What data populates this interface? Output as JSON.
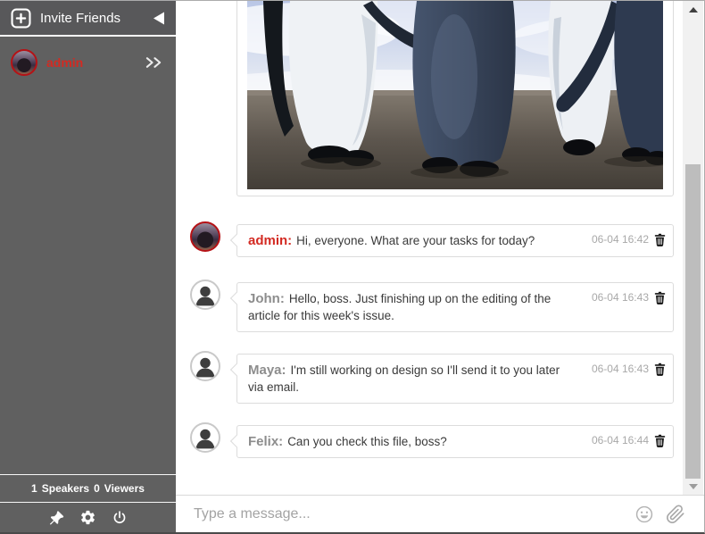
{
  "sidebar": {
    "invite_label": "Invite Friends",
    "user": {
      "name": "admin"
    },
    "status": {
      "speakers_count": "1",
      "speakers_label": "Speakers",
      "viewers_count": "0",
      "viewers_label": "Viewers"
    }
  },
  "chat": {
    "photo_message": {
      "alt": "penguins walking on a beach"
    },
    "messages": [
      {
        "author": "admin:",
        "text": "Hi, everyone. What are your tasks for today?",
        "time": "06-04 16:42"
      },
      {
        "author": "John:",
        "text": "Hello, boss. Just finishing up on the editing of the article for this week's issue.",
        "time": "06-04 16:43"
      },
      {
        "author": "Maya:",
        "text": "I'm still working on design so I'll send it to you later via email.",
        "time": "06-04 16:43"
      },
      {
        "author": "Felix:",
        "text": "Can you check this file, boss?",
        "time": "06-04 16:44"
      }
    ]
  },
  "composer": {
    "placeholder": "Type a message..."
  },
  "icons": {
    "sidebar": [
      "invite-plus-icon",
      "collapse-arrow-icon",
      "double-chevron-right-icon",
      "pin-icon",
      "settings-gear-icon",
      "power-icon"
    ],
    "messages": [
      "person-avatar-icon",
      "trash-icon"
    ],
    "composer": [
      "emoji-smiley-icon",
      "paperclip-attachment-icon"
    ],
    "scrollbar": [
      "scroll-up-arrow",
      "scroll-down-arrow"
    ]
  },
  "colors": {
    "accent_red": "#d32a22",
    "sidebar_gray": "#606060",
    "author_gray": "#8d8d8d",
    "timestamp_gray": "#a8a8a8",
    "scrollbar_thumb": "#bdbdbd"
  }
}
